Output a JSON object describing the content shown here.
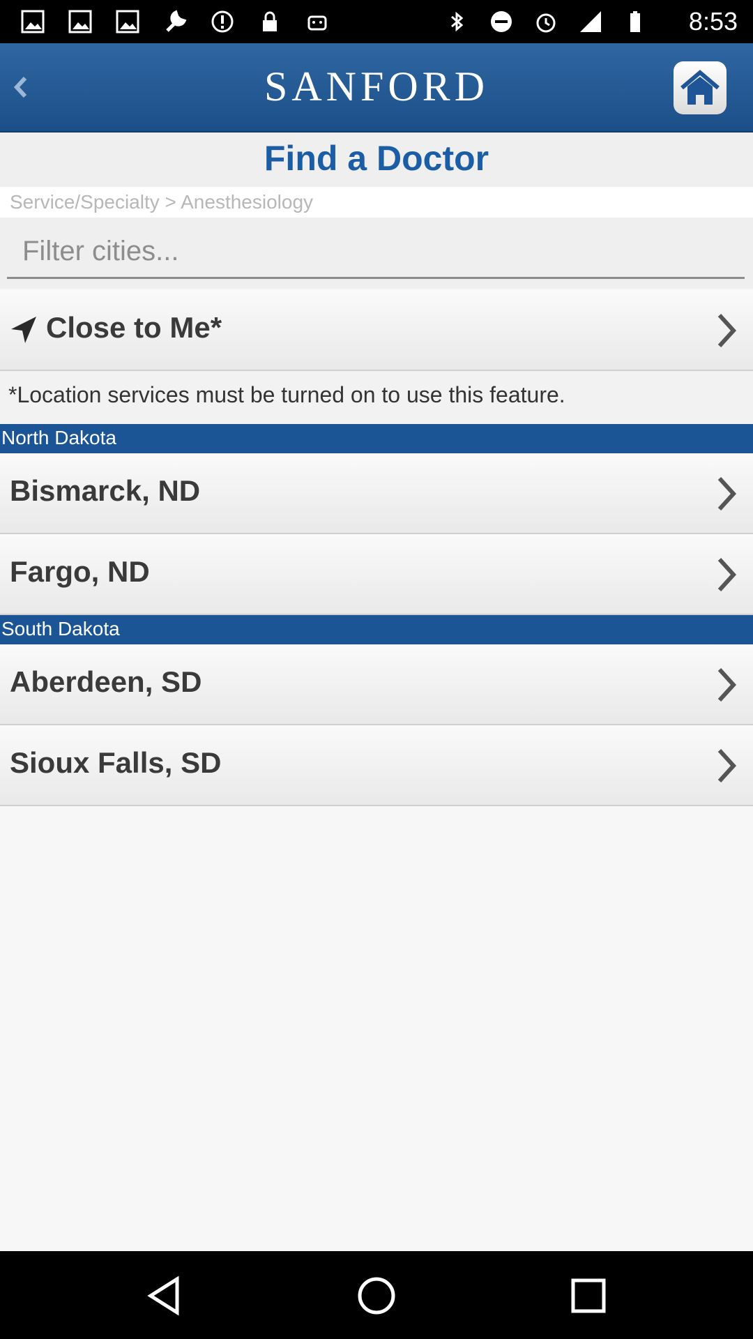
{
  "status_bar": {
    "time": "8:53"
  },
  "header": {
    "logo": "SANFORD"
  },
  "page": {
    "title": "Find a Doctor",
    "breadcrumb": "Service/Specialty > Anesthesiology",
    "filter_placeholder": "Filter cities..."
  },
  "close_to_me": {
    "label": "Close to Me*",
    "note": "*Location services must be turned on to use this feature."
  },
  "sections": [
    {
      "name": "North Dakota",
      "cities": [
        "Bismarck, ND",
        "Fargo, ND"
      ]
    },
    {
      "name": "South Dakota",
      "cities": [
        "Aberdeen, SD",
        "Sioux Falls, SD"
      ]
    }
  ],
  "icons": {
    "status_left": [
      "photo-icon",
      "photo-icon",
      "photo-icon",
      "wrench-icon",
      "alert-icon",
      "lock-icon",
      "android-icon"
    ],
    "status_right": [
      "bluetooth-icon",
      "do-not-disturb-icon",
      "alarm-icon",
      "signal-icon",
      "battery-icon"
    ],
    "header": [
      "back-icon",
      "home-icon"
    ],
    "rows": [
      "navigation-arrow-icon",
      "chevron-right-icon"
    ],
    "nav": [
      "back-triangle-icon",
      "home-circle-icon",
      "recents-square-icon"
    ]
  },
  "colors": {
    "brand_blue": "#1c4f88",
    "title_blue": "#1b5ea5",
    "section_blue": "#1b5596"
  }
}
